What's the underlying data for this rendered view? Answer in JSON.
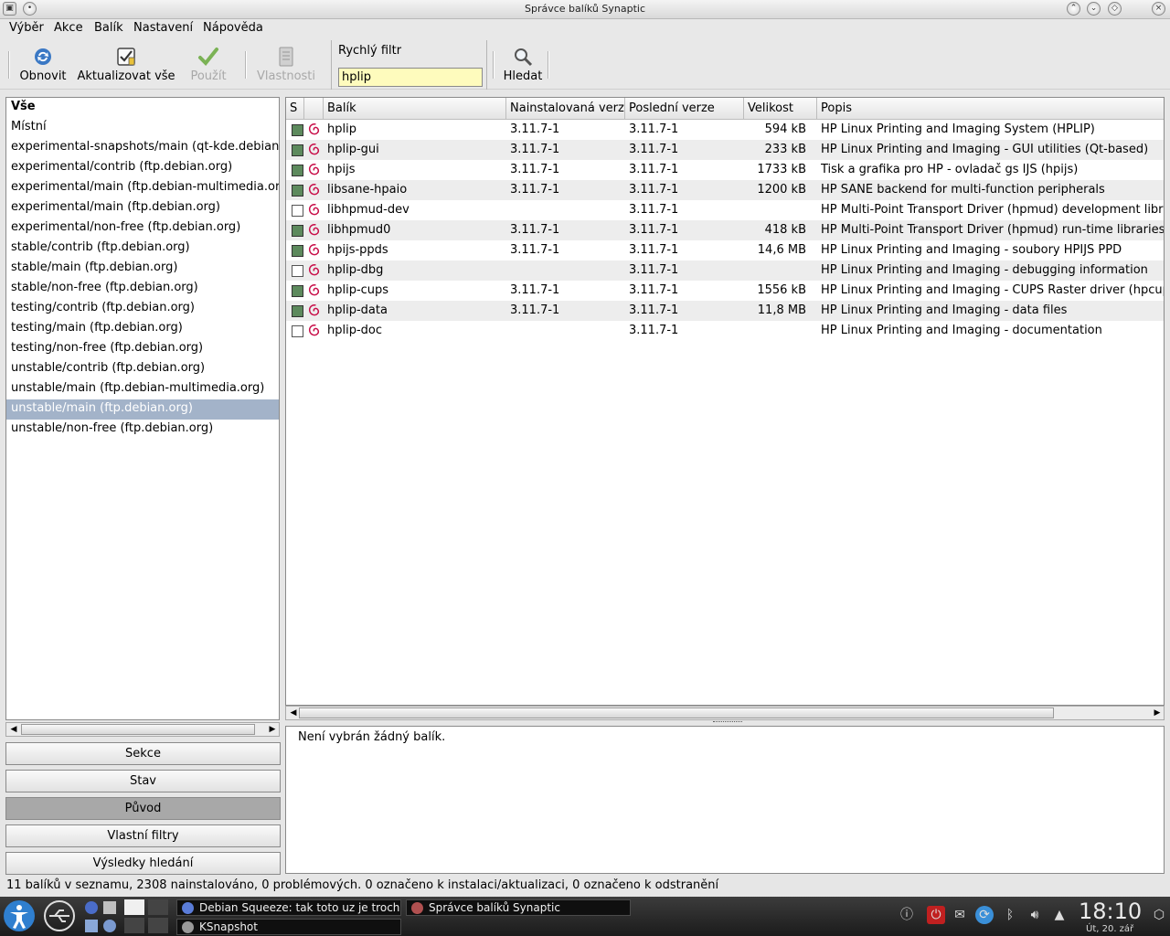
{
  "window": {
    "title": "Správce balíků Synaptic"
  },
  "menu": [
    "Výběr",
    "Akce",
    "Balík",
    "Nastavení",
    "Nápověda"
  ],
  "toolbar": {
    "reload": "Obnovit",
    "upgrade_all": "Aktualizovat vše",
    "apply": "Použít",
    "properties": "Vlastnosti",
    "quick_filter_label": "Rychlý filtr",
    "quick_filter_value": "hplip",
    "search": "Hledat"
  },
  "origins": [
    "Vše",
    "Místní",
    "experimental-snapshots/main (qt-kde.debian.net)",
    "experimental/contrib (ftp.debian.org)",
    "experimental/main (ftp.debian-multimedia.org)",
    "experimental/main (ftp.debian.org)",
    "experimental/non-free (ftp.debian.org)",
    "stable/contrib (ftp.debian.org)",
    "stable/main (ftp.debian.org)",
    "stable/non-free (ftp.debian.org)",
    "testing/contrib (ftp.debian.org)",
    "testing/main (ftp.debian.org)",
    "testing/non-free (ftp.debian.org)",
    "unstable/contrib (ftp.debian.org)",
    "unstable/main (ftp.debian-multimedia.org)",
    "unstable/main (ftp.debian.org)",
    "unstable/non-free (ftp.debian.org)"
  ],
  "selected_origin": "unstable/main (ftp.debian.org)",
  "view_buttons": {
    "sections": "Sekce",
    "status": "Stav",
    "origin": "Původ",
    "custom_filters": "Vlastní filtry",
    "search_results": "Výsledky hledání"
  },
  "columns": {
    "s": "S",
    "package": "Balík",
    "installed": "Nainstalovaná verze",
    "latest": "Poslední verze",
    "size": "Velikost",
    "description": "Popis"
  },
  "packages": [
    {
      "installed_flag": true,
      "name": "hplip",
      "installed": "3.11.7-1",
      "latest": "3.11.7-1",
      "size": "594 kB",
      "desc": "HP Linux Printing and Imaging System (HPLIP)"
    },
    {
      "installed_flag": true,
      "name": "hplip-gui",
      "installed": "3.11.7-1",
      "latest": "3.11.7-1",
      "size": "233 kB",
      "desc": "HP Linux Printing and Imaging - GUI utilities (Qt-based)"
    },
    {
      "installed_flag": true,
      "name": "hpijs",
      "installed": "3.11.7-1",
      "latest": "3.11.7-1",
      "size": "1733 kB",
      "desc": "Tisk a grafika pro HP - ovladač gs IJS (hpijs)"
    },
    {
      "installed_flag": true,
      "name": "libsane-hpaio",
      "installed": "3.11.7-1",
      "latest": "3.11.7-1",
      "size": "1200 kB",
      "desc": "HP SANE backend for multi-function peripherals"
    },
    {
      "installed_flag": false,
      "name": "libhpmud-dev",
      "installed": "",
      "latest": "3.11.7-1",
      "size": "",
      "desc": "HP Multi-Point Transport Driver (hpmud) development libraries"
    },
    {
      "installed_flag": true,
      "name": "libhpmud0",
      "installed": "3.11.7-1",
      "latest": "3.11.7-1",
      "size": "418 kB",
      "desc": "HP Multi-Point Transport Driver (hpmud) run-time libraries"
    },
    {
      "installed_flag": true,
      "name": "hpijs-ppds",
      "installed": "3.11.7-1",
      "latest": "3.11.7-1",
      "size": "14,6 MB",
      "desc": "HP Linux Printing and Imaging - soubory HPIJS PPD"
    },
    {
      "installed_flag": false,
      "name": "hplip-dbg",
      "installed": "",
      "latest": "3.11.7-1",
      "size": "",
      "desc": "HP Linux Printing and Imaging - debugging information"
    },
    {
      "installed_flag": true,
      "name": "hplip-cups",
      "installed": "3.11.7-1",
      "latest": "3.11.7-1",
      "size": "1556 kB",
      "desc": "HP Linux Printing and Imaging - CUPS Raster driver (hpcups)"
    },
    {
      "installed_flag": true,
      "name": "hplip-data",
      "installed": "3.11.7-1",
      "latest": "3.11.7-1",
      "size": "11,8 MB",
      "desc": "HP Linux Printing and Imaging - data files"
    },
    {
      "installed_flag": false,
      "name": "hplip-doc",
      "installed": "",
      "latest": "3.11.7-1",
      "size": "",
      "desc": "HP Linux Printing and Imaging - documentation"
    }
  ],
  "description_panel": "Není vybrán žádný balík.",
  "status_bar": "11 balíků v seznamu, 2308 nainstalováno, 0 problémových. 0 označeno k instalaci/aktualizaci, 0 označeno k odstranění",
  "taskbar": {
    "tasks": [
      "Debian Squeeze: tak toto uz je trochu",
      "Správce balíků Synaptic",
      "KSnapshot"
    ],
    "time": "18:10",
    "date": "Út, 20. zář"
  },
  "colors": {
    "selection": "#a3b3c9",
    "installed_box": "#5d8a5d",
    "filter_bg": "#fefbbd",
    "debian": "#c8104a"
  }
}
